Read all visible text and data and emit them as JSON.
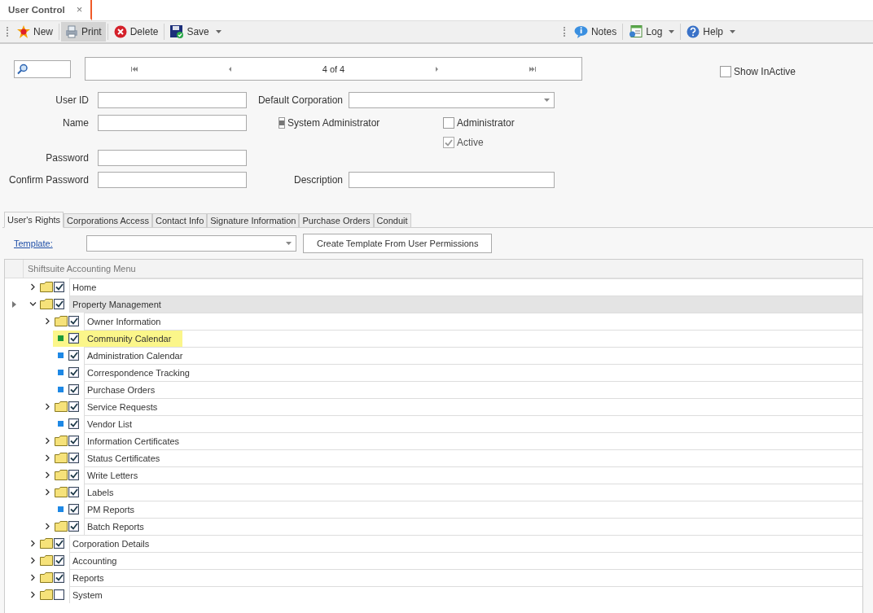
{
  "document_tab": {
    "title": "User Control",
    "close": "×"
  },
  "toolbar": {
    "left": [
      {
        "kind": "new",
        "label": "New",
        "selected": false,
        "dropdown": false
      },
      {
        "kind": "print",
        "label": "Print",
        "selected": true,
        "dropdown": false
      },
      {
        "kind": "delete",
        "label": "Delete",
        "selected": false,
        "dropdown": false
      },
      {
        "kind": "save",
        "label": "Save",
        "selected": false,
        "dropdown": true
      }
    ],
    "right": [
      {
        "kind": "notes",
        "label": "Notes",
        "selected": false,
        "dropdown": false
      },
      {
        "kind": "log",
        "label": "Log",
        "selected": false,
        "dropdown": true
      },
      {
        "kind": "help",
        "label": "Help",
        "selected": false,
        "dropdown": true
      }
    ]
  },
  "navigator": {
    "position": "4 of 4"
  },
  "show_inactive": {
    "label": "Show InActive",
    "checked": false
  },
  "form": {
    "user_id": {
      "label": "User ID"
    },
    "name": {
      "label": "Name"
    },
    "password": {
      "label": "Password"
    },
    "confirm_password": {
      "label": "Confirm Password"
    },
    "default_corporation": {
      "label": "Default Corporation"
    },
    "description": {
      "label": "Description"
    },
    "system_administrator": {
      "label": "System Administrator",
      "checked": false,
      "indeterminate": true,
      "disabled": false
    },
    "administrator": {
      "label": "Administrator",
      "checked": false,
      "disabled": false
    },
    "active": {
      "label": "Active",
      "checked": true,
      "disabled": true
    }
  },
  "tabs": [
    {
      "label": "User's Rights",
      "selected": true
    },
    {
      "label": "Corporations Access",
      "selected": false
    },
    {
      "label": "Contact Info",
      "selected": false
    },
    {
      "label": "Signature Information",
      "selected": false
    },
    {
      "label": "Purchase Orders",
      "selected": false
    },
    {
      "label": "Conduit",
      "selected": false
    }
  ],
  "template": {
    "label": "Template:",
    "button": "Create Template From User Permissions"
  },
  "tree": {
    "header": "Shiftsuite Accounting Menu",
    "items": [
      {
        "kind": "folder",
        "label": "Home",
        "checked": true,
        "expanded": false,
        "selected": false,
        "highlighted": false
      },
      {
        "kind": "folder",
        "label": "Property Management",
        "checked": true,
        "expanded": true,
        "selected": true,
        "highlighted": false,
        "children": [
          {
            "kind": "folder",
            "label": "Owner Information",
            "checked": true,
            "expanded": false,
            "selected": false,
            "highlighted": false
          },
          {
            "kind": "item",
            "label": "Community Calendar",
            "checked": true,
            "selected": false,
            "highlighted": true,
            "color": "#1a9a3a"
          },
          {
            "kind": "item",
            "label": "Administration Calendar",
            "checked": true,
            "selected": false,
            "highlighted": false,
            "color": "#1e88e5"
          },
          {
            "kind": "item",
            "label": "Correspondence Tracking",
            "checked": true,
            "selected": false,
            "highlighted": false,
            "color": "#1e88e5"
          },
          {
            "kind": "item",
            "label": "Purchase Orders",
            "checked": true,
            "selected": false,
            "highlighted": false,
            "color": "#1e88e5"
          },
          {
            "kind": "folder",
            "label": "Service Requests",
            "checked": true,
            "expanded": false,
            "selected": false,
            "highlighted": false
          },
          {
            "kind": "item",
            "label": "Vendor List",
            "checked": true,
            "selected": false,
            "highlighted": false,
            "color": "#1e88e5"
          },
          {
            "kind": "folder",
            "label": "Information Certificates",
            "checked": true,
            "expanded": false,
            "selected": false,
            "highlighted": false
          },
          {
            "kind": "folder",
            "label": "Status Certificates",
            "checked": true,
            "expanded": false,
            "selected": false,
            "highlighted": false
          },
          {
            "kind": "folder",
            "label": "Write Letters",
            "checked": true,
            "expanded": false,
            "selected": false,
            "highlighted": false
          },
          {
            "kind": "folder",
            "label": "Labels",
            "checked": true,
            "expanded": false,
            "selected": false,
            "highlighted": false
          },
          {
            "kind": "item",
            "label": "PM Reports",
            "checked": true,
            "selected": false,
            "highlighted": false,
            "color": "#1e88e5"
          },
          {
            "kind": "folder",
            "label": "Batch Reports",
            "checked": true,
            "expanded": false,
            "selected": false,
            "highlighted": false
          }
        ]
      },
      {
        "kind": "folder",
        "label": "Corporation Details",
        "checked": true,
        "expanded": false,
        "selected": false,
        "highlighted": false
      },
      {
        "kind": "folder",
        "label": "Accounting",
        "checked": true,
        "expanded": false,
        "selected": false,
        "highlighted": false
      },
      {
        "kind": "folder",
        "label": "Reports",
        "checked": true,
        "expanded": false,
        "selected": false,
        "highlighted": false
      },
      {
        "kind": "folder",
        "label": "System",
        "checked": false,
        "expanded": false,
        "selected": false,
        "highlighted": false
      }
    ]
  }
}
